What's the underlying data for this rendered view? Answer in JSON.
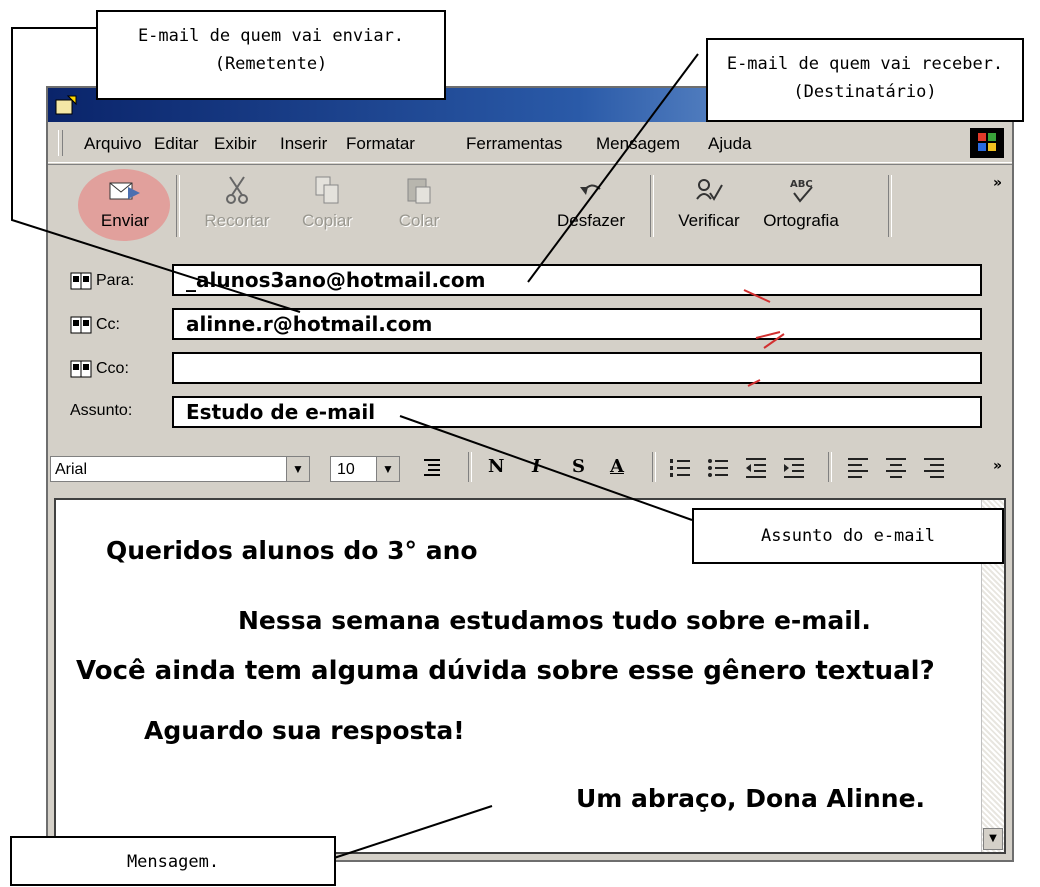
{
  "menu": [
    "Arquivo",
    "Editar",
    "Exibir",
    "Inserir",
    "Formatar",
    "Ferramentas",
    "Mensagem",
    "Ajuda"
  ],
  "toolbar": {
    "send": "Enviar",
    "cut": "Recortar",
    "copy": "Copiar",
    "paste": "Colar",
    "undo": "Desfazer",
    "check": "Verificar",
    "spelling": "Ortografia",
    "more": "»"
  },
  "headers": {
    "to_label": "Para:",
    "to_value": "_alunos3ano@hotmail.com",
    "cc_label": "Cc:",
    "cc_value": "alinne.r@hotmail.com",
    "bcc_label": "Cco:",
    "bcc_value": "",
    "subject_label": "Assunto:",
    "subject_value": "Estudo de e-mail"
  },
  "format": {
    "font": "Arial",
    "size": "10",
    "bold": "N",
    "italic": "I",
    "underline": "S",
    "color": "A",
    "more": "»"
  },
  "message": {
    "line1": "Queridos alunos do 3° ano",
    "line2": "Nessa semana estudamos tudo sobre e-mail.",
    "line3": "Você ainda tem alguma dúvida sobre esse gênero textual?",
    "line4": "Aguardo sua resposta!",
    "line5": "Um abraço, Dona Alinne."
  },
  "callouts": {
    "sender_line1": "E-mail de quem vai enviar.",
    "sender_line2": "(Remetente)",
    "recipient_line1": "E-mail de quem vai receber.",
    "recipient_line2": "(Destinatário)",
    "subject": "Assunto do e-mail",
    "message": "Mensagem."
  },
  "colors": {
    "titlebar_start": "#0a246a",
    "titlebar_end": "#a6caf0",
    "window_face": "#d4d0c8",
    "send_highlight": "#eb7878"
  }
}
